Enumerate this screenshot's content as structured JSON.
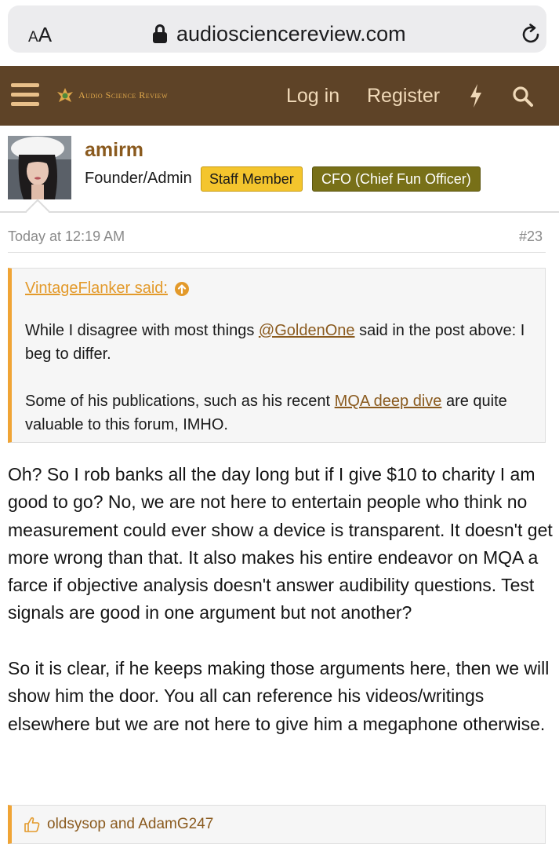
{
  "browser": {
    "text_size_label_small": "A",
    "text_size_label_large": "A",
    "url": "audiosciencereview.com",
    "icons": [
      "lock-icon",
      "reload-icon"
    ]
  },
  "site_nav": {
    "logo_text": "Audio Science Review",
    "login_label": "Log in",
    "register_label": "Register",
    "icons": [
      "menu-icon",
      "bolt-icon",
      "search-icon"
    ]
  },
  "post": {
    "author": {
      "username": "amirm",
      "user_title": "Founder/Admin",
      "badges": [
        "Staff Member",
        "CFO (Chief Fun Officer)"
      ]
    },
    "timestamp": "Today at 12:19 AM",
    "post_number": "#23",
    "quote": {
      "author_label": "VintageFlanker said:",
      "line1_before": "While I disagree with most things ",
      "mention": "@GoldenOne",
      "line1_after": " said in the post above: I beg to differ.",
      "line2_before": "Some of his publications, such as his recent ",
      "link_text": "MQA deep dive",
      "line2_after": " are quite valuable to this forum, IMHO."
    },
    "paragraphs": [
      "Oh? So I rob banks all the day long but if I give $10 to charity I am good to go? No, we are not here to entertain people who think no measurement could ever show a device is transparent. It doesn't get more wrong than that. It also makes his entire endeavor on MQA a farce if objective analysis doesn't answer audibility questions. Test signals are good in one argument but not another?",
      "So it is clear, if he keeps making those arguments here, then we will show him the door. You all can reference his videos/writings elsewhere but we are not here to give him a megaphone otherwise."
    ],
    "reactions_text": "oldsysop and AdamG247"
  },
  "colors": {
    "nav_background": "#5e4327",
    "accent_orange": "#f0a435",
    "username_brown": "#8a5a1e",
    "staff_badge": "#f4c52d",
    "cfo_badge": "#787018"
  }
}
